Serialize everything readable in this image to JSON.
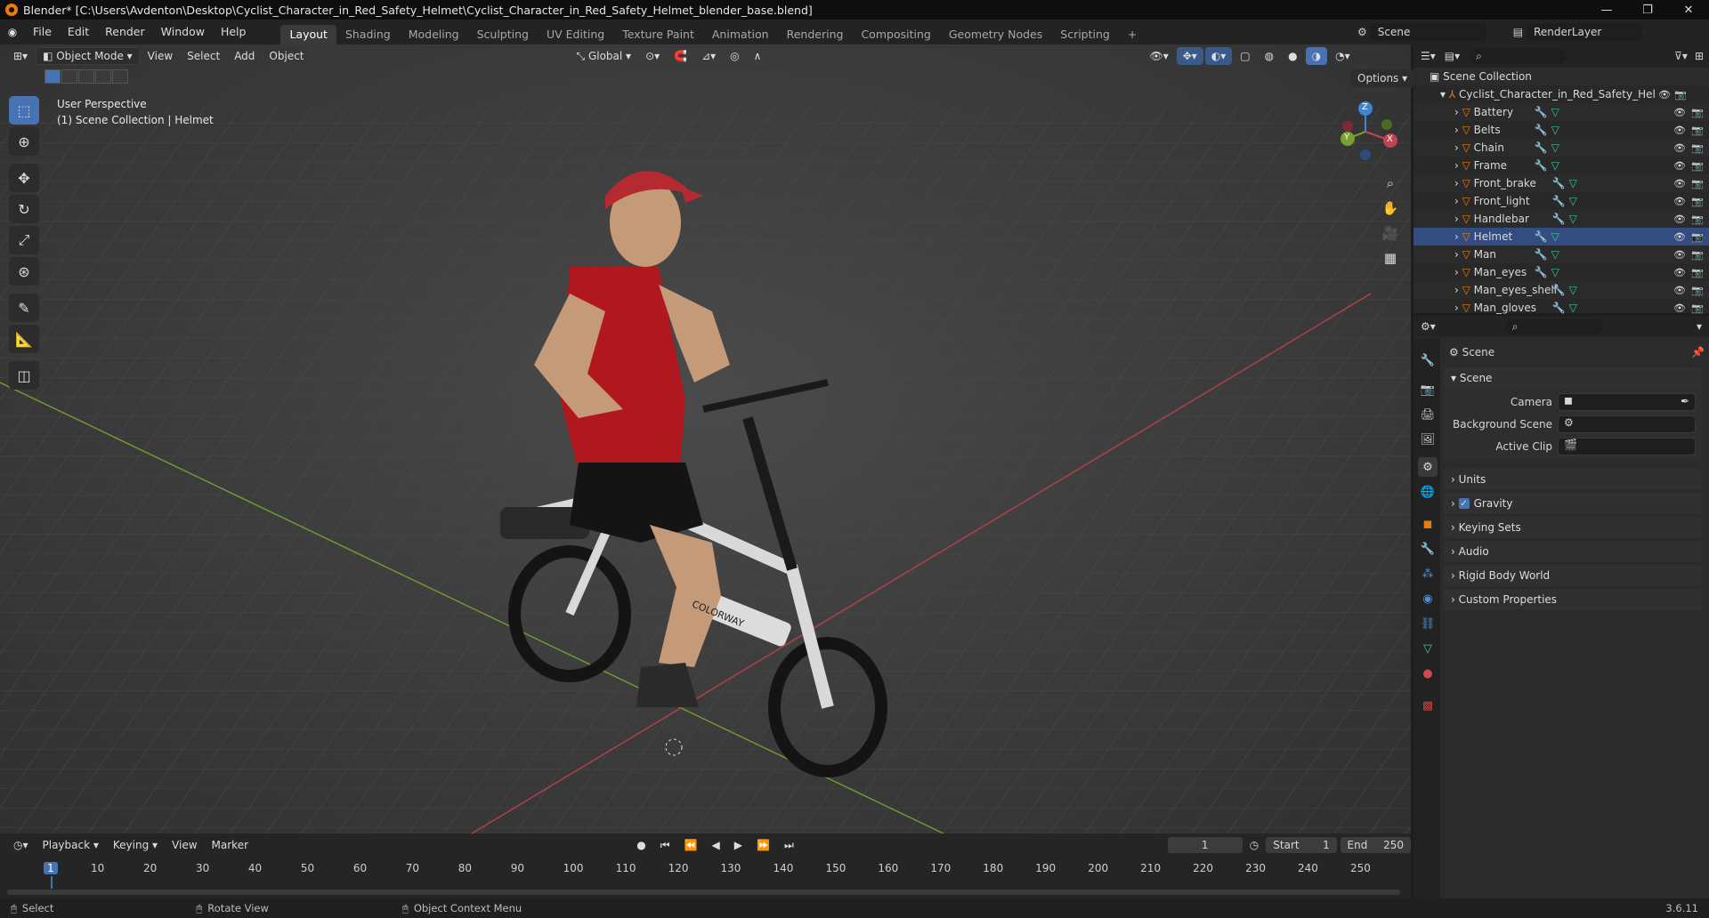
{
  "window": {
    "title": "Blender* [C:\\Users\\Avdenton\\Desktop\\Cyclist_Character_in_Red_Safety_Helmet\\Cyclist_Character_in_Red_Safety_Helmet_blender_base.blend]"
  },
  "menu": [
    "File",
    "Edit",
    "Render",
    "Window",
    "Help"
  ],
  "workspaces": [
    "Layout",
    "Shading",
    "Modeling",
    "Sculpting",
    "UV Editing",
    "Texture Paint",
    "Animation",
    "Rendering",
    "Compositing",
    "Geometry Nodes",
    "Scripting"
  ],
  "top_right": {
    "scene": "Scene",
    "view_layer": "RenderLayer"
  },
  "viewport": {
    "mode": "Object Mode",
    "menus": [
      "View",
      "Select",
      "Add",
      "Object"
    ],
    "transform_orientation": "Global",
    "options_label": "Options",
    "info_line1": "User Perspective",
    "info_line2": "(1) Scene Collection | Helmet",
    "branding_text": "COLORWAY"
  },
  "gizmo": {
    "x": "X",
    "y": "Y",
    "z": "Z"
  },
  "outliner": {
    "root": "Scene Collection",
    "collection": "Cyclist_Character_in_Red_Safety_Helme",
    "items": [
      "Battery",
      "Belts",
      "Chain",
      "Frame",
      "Front_brake",
      "Front_light",
      "Handlebar",
      "Helmet",
      "Man",
      "Man_eyes",
      "Man_eyes_shell",
      "Man_gloves"
    ]
  },
  "properties": {
    "header": "Scene",
    "section": "Scene",
    "fields": [
      {
        "label": "Camera",
        "value": ""
      },
      {
        "label": "Background Scene",
        "value": ""
      },
      {
        "label": "Active Clip",
        "value": ""
      }
    ],
    "panels": [
      "Units",
      "Gravity",
      "Keying Sets",
      "Audio",
      "Rigid Body World",
      "Custom Properties"
    ]
  },
  "timeline": {
    "menus": [
      "Playback",
      "Keying",
      "View",
      "Marker"
    ],
    "current_frame": "1",
    "start_label": "Start",
    "start": "1",
    "end_label": "End",
    "end": "250",
    "ticks": [
      "1",
      "10",
      "20",
      "30",
      "40",
      "50",
      "60",
      "70",
      "80",
      "90",
      "100",
      "110",
      "120",
      "130",
      "140",
      "150",
      "160",
      "170",
      "180",
      "190",
      "200",
      "210",
      "220",
      "230",
      "240",
      "250"
    ]
  },
  "status": {
    "select": "Select",
    "rotate": "Rotate View",
    "context": "Object Context Menu",
    "version": "3.6.11"
  },
  "colors": {
    "accent": "#4772b3",
    "orange": "#e87d0d",
    "x_axis": "#c44350",
    "y_axis": "#7aa12e",
    "z_axis": "#3d85d6"
  }
}
